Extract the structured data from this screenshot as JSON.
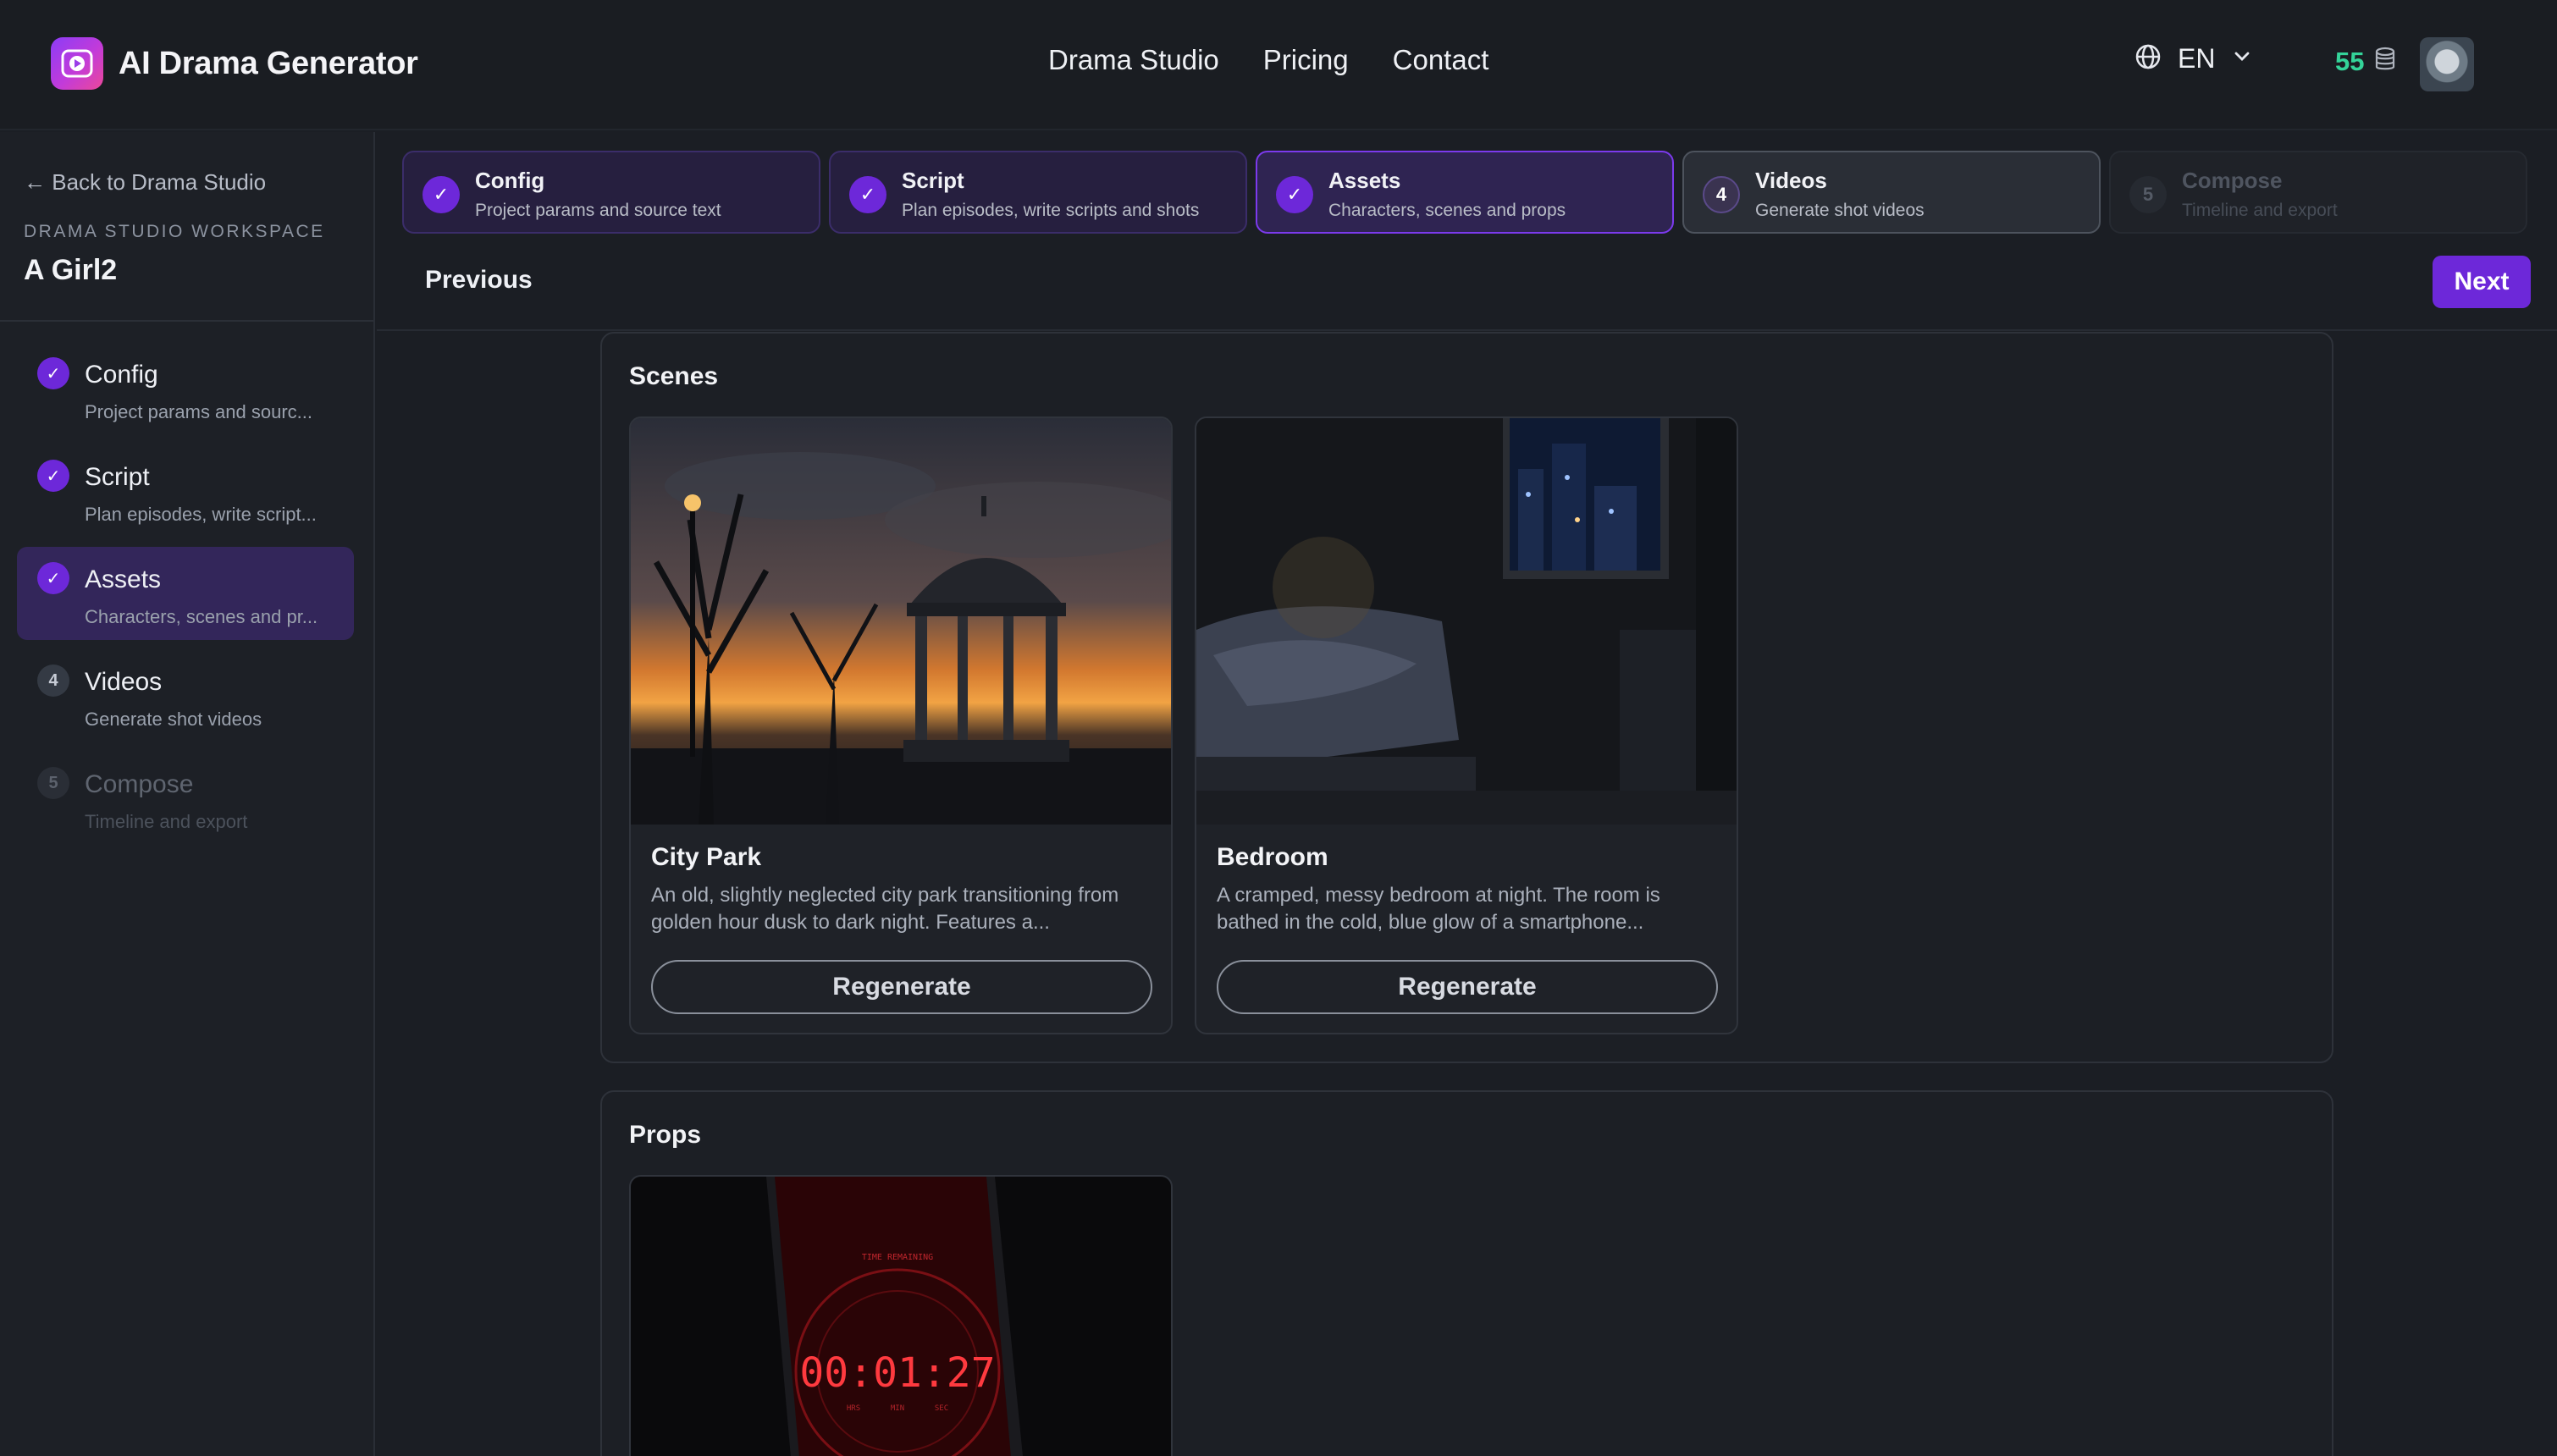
{
  "app": {
    "name": "AI Drama Generator",
    "nav": [
      "Drama Studio",
      "Pricing",
      "Contact"
    ],
    "language": "EN",
    "credits": "55"
  },
  "sidebar": {
    "back_label": "← Back to Drama Studio",
    "workspace_label": "DRAMA STUDIO WORKSPACE",
    "workspace_title": "A Girl2",
    "steps": [
      {
        "marker": "✓",
        "title": "Config",
        "desc": "Project params and sourc...",
        "state": "done"
      },
      {
        "marker": "✓",
        "title": "Script",
        "desc": "Plan episodes, write script...",
        "state": "done"
      },
      {
        "marker": "✓",
        "title": "Assets",
        "desc": "Characters, scenes and pr...",
        "state": "active"
      },
      {
        "marker": "4",
        "title": "Videos",
        "desc": "Generate shot videos",
        "state": "pending"
      },
      {
        "marker": "5",
        "title": "Compose",
        "desc": "Timeline and export",
        "state": "disabled"
      }
    ]
  },
  "stepper": [
    {
      "marker": "✓",
      "title": "Config",
      "desc": "Project params and source text",
      "state": "done"
    },
    {
      "marker": "✓",
      "title": "Script",
      "desc": "Plan episodes, write scripts and shots",
      "state": "done"
    },
    {
      "marker": "✓",
      "title": "Assets",
      "desc": "Characters, scenes and props",
      "state": "current"
    },
    {
      "marker": "4",
      "title": "Videos",
      "desc": "Generate shot videos",
      "state": "next"
    },
    {
      "marker": "5",
      "title": "Compose",
      "desc": "Timeline and export",
      "state": "disabled"
    }
  ],
  "toolbar": {
    "previous_label": "Previous",
    "next_label": "Next"
  },
  "scenes": {
    "title": "Scenes",
    "items": [
      {
        "name": "City Park",
        "desc": "An old, slightly neglected city park transitioning from golden hour dusk to dark night. Features a...",
        "button": "Regenerate"
      },
      {
        "name": "Bedroom",
        "desc": "A cramped, messy bedroom at night. The room is bathed in the cold, blue glow of a smartphone...",
        "button": "Regenerate"
      }
    ]
  },
  "props": {
    "title": "Props",
    "items": [
      {
        "timer": "00:01:27",
        "timer_caption": "TIME REMAINING",
        "units": [
          "HRS",
          "MIN",
          "SEC"
        ]
      }
    ]
  },
  "colors": {
    "accent": "#6d28d9",
    "credits": "#34d399",
    "background": "#1b1e24"
  }
}
